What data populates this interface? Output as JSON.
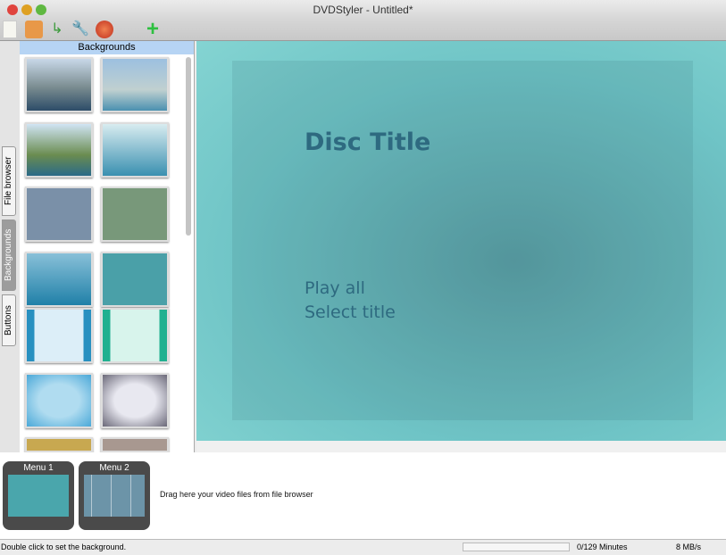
{
  "window": {
    "title": "DVDStyler - Untitled*"
  },
  "toolbar": {
    "icons": [
      "new-icon",
      "open-folder-icon",
      "add-file-icon",
      "settings-wrench-icon",
      "burn-disc-icon",
      "add-icon"
    ]
  },
  "side_tabs": [
    "File browser",
    "Backgrounds",
    "Buttons"
  ],
  "panel": {
    "title": "Backgrounds"
  },
  "canvas": {
    "title": "Disc Title",
    "buttons": [
      "Play all",
      "Select title"
    ]
  },
  "menus": [
    {
      "label": "Menu 1"
    },
    {
      "label": "Menu 2"
    }
  ],
  "drop_hint": "Drag here your video files from file browser",
  "status": {
    "message": "Double click to set the background.",
    "minutes": "0/129 Minutes",
    "speed": "8 MB/s",
    "progress": 0
  }
}
